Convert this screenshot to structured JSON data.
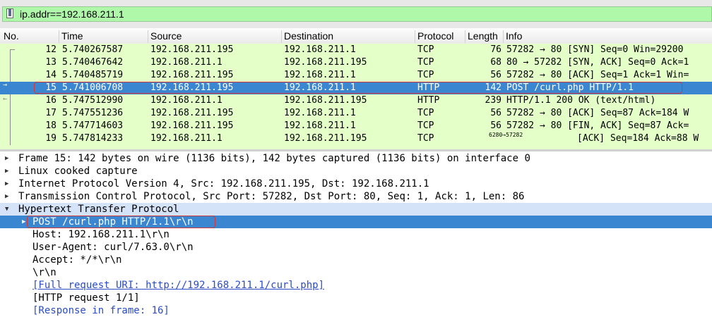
{
  "filter": {
    "value": "ip.addr==192.168.211.1",
    "bg_color": "#aff7a9"
  },
  "columns": [
    "No.",
    "Time",
    "Source",
    "Destination",
    "Protocol",
    "Length",
    "Info"
  ],
  "packets": [
    {
      "no": "12",
      "time": "5.740267587",
      "src": "192.168.211.195",
      "dst": "192.168.211.1",
      "proto": "TCP",
      "len": "76",
      "info": "57282 → 80 [SYN] Seq=0 Win=29200 "
    },
    {
      "no": "13",
      "time": "5.740467642",
      "src": "192.168.211.1",
      "dst": "192.168.211.195",
      "proto": "TCP",
      "len": "68",
      "info": "80 → 57282 [SYN, ACK] Seq=0 Ack=1"
    },
    {
      "no": "14",
      "time": "5.740485719",
      "src": "192.168.211.195",
      "dst": "192.168.211.1",
      "proto": "TCP",
      "len": "56",
      "info": "57282 → 80 [ACK] Seq=1 Ack=1 Win="
    },
    {
      "no": "15",
      "time": "5.741006708",
      "src": "192.168.211.195",
      "dst": "192.168.211.1",
      "proto": "HTTP",
      "len": "142",
      "info": "POST /curl.php HTTP/1.1"
    },
    {
      "no": "16",
      "time": "5.747512990",
      "src": "192.168.211.1",
      "dst": "192.168.211.195",
      "proto": "HTTP",
      "len": "239",
      "info": "HTTP/1.1 200 OK  (text/html)"
    },
    {
      "no": "17",
      "time": "5.747551236",
      "src": "192.168.211.195",
      "dst": "192.168.211.1",
      "proto": "TCP",
      "len": "56",
      "info": "57282 → 80 [ACK] Seq=87 Ack=184 W"
    },
    {
      "no": "18",
      "time": "5.747714603",
      "src": "192.168.211.195",
      "dst": "192.168.211.1",
      "proto": "TCP",
      "len": "56",
      "info": "57282 → 80 [FIN, ACK] Seq=87 Ack="
    },
    {
      "no": "19",
      "time": "5.747814233",
      "src": "192.168.211.1",
      "dst": "192.168.211.195",
      "proto": "TCP",
      "len": "6280→57282",
      "info": "[ACK] Seq=184 Ack=88 W"
    }
  ],
  "selected_packet": "15",
  "details": [
    {
      "text": "Frame 15: 142 bytes on wire (1136 bits), 142 bytes captured (1136 bits) on interface 0",
      "expander": "collapsed"
    },
    {
      "text": "Linux cooked capture",
      "expander": "collapsed"
    },
    {
      "text": "Internet Protocol Version 4, Src: 192.168.211.195, Dst: 192.168.211.1",
      "expander": "collapsed"
    },
    {
      "text": "Transmission Control Protocol, Src Port: 57282, Dst Port: 80, Seq: 1, Ack: 1, Len: 86",
      "expander": "collapsed"
    },
    {
      "text": "Hypertext Transfer Protocol",
      "expander": "expanded"
    },
    {
      "text": "POST /curl.php HTTP/1.1\\r\\n",
      "expander": "collapsed"
    },
    {
      "text": "Host: 192.168.211.1\\r\\n"
    },
    {
      "text": "User-Agent: curl/7.63.0\\r\\n"
    },
    {
      "text": "Accept: */*\\r\\n"
    },
    {
      "text": "\\r\\n"
    },
    {
      "text": "[Full request URI: http://192.168.211.1/curl.php]"
    },
    {
      "text": "[HTTP request 1/1]"
    },
    {
      "text": "[Response in frame: 16]"
    }
  ],
  "colors": {
    "row_green": "#e4ffc7",
    "selected_blue": "#3b86d0",
    "highlight_red": "#d0383a",
    "link_blue": "#2a4cc6"
  }
}
